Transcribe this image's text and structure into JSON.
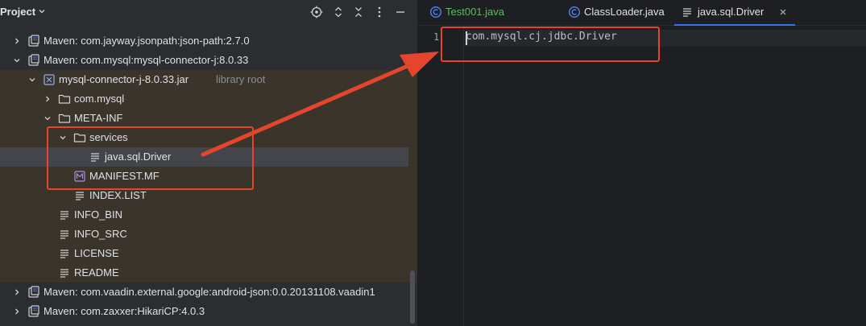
{
  "project": {
    "title": "Project",
    "items": [
      {
        "label": "Maven: com.jayway.jsonpath:json-path:2.7.0",
        "icon": "library-icon",
        "expanded": false
      },
      {
        "label": "Maven: com.mysql:mysql-connector-j:8.0.33",
        "icon": "library-icon",
        "expanded": true
      },
      {
        "label": "mysql-connector-j-8.0.33.jar",
        "suffix": "library root",
        "icon": "jar-icon",
        "expanded": true
      },
      {
        "label": "com.mysql",
        "icon": "folder-icon",
        "expanded": false
      },
      {
        "label": "META-INF",
        "icon": "folder-icon",
        "expanded": true
      },
      {
        "label": "services",
        "icon": "folder-icon",
        "expanded": true
      },
      {
        "label": "java.sql.Driver",
        "icon": "text-file-icon",
        "selected": true
      },
      {
        "label": "MANIFEST.MF",
        "icon": "manifest-file-icon"
      },
      {
        "label": "INDEX.LIST",
        "icon": "text-file-icon"
      },
      {
        "label": "INFO_BIN",
        "icon": "text-file-icon"
      },
      {
        "label": "INFO_SRC",
        "icon": "text-file-icon"
      },
      {
        "label": "LICENSE",
        "icon": "text-file-icon"
      },
      {
        "label": "README",
        "icon": "text-file-icon"
      },
      {
        "label": "Maven: com.vaadin.external.google:android-json:0.0.20131108.vaadin1",
        "icon": "library-icon",
        "expanded": false
      },
      {
        "label": "Maven: com.zaxxer:HikariCP:4.0.3",
        "icon": "library-icon",
        "expanded": false
      }
    ]
  },
  "editor": {
    "tabs": [
      {
        "label": "Test001.java",
        "icon": "java-class-icon",
        "color": "#5fb865"
      },
      {
        "label": "ClassLoader.java",
        "icon": "java-class-icon"
      },
      {
        "label": "java.sql.Driver",
        "icon": "text-file-icon",
        "active": true
      }
    ],
    "line_number": "1",
    "code": "com.mysql.cj.jdbc.Driver"
  },
  "colors": {
    "accent": "#3574f0",
    "annotation": "#e5452d",
    "library_root_bg": "#3a342a",
    "selection_bg": "#43454a"
  }
}
